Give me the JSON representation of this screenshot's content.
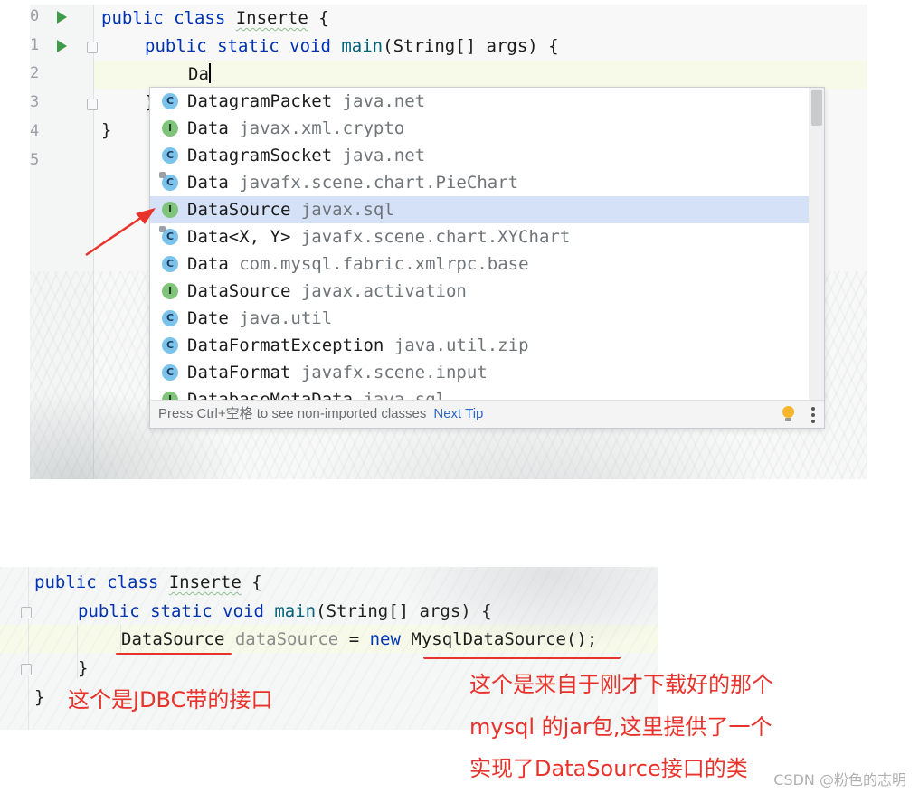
{
  "editor_top": {
    "line_numbers": [
      "0",
      "1",
      "2",
      "3",
      "4",
      "5"
    ],
    "code": {
      "line1": {
        "kw": "public class",
        "name": "Inserte",
        "brace": "{"
      },
      "line2": {
        "kw": "public static void",
        "fn": "main",
        "rest": "(String[] args) {"
      },
      "line3": {
        "typed": "Da"
      },
      "line4": {
        "text": "}"
      },
      "line5": {
        "text": "}"
      }
    }
  },
  "completion_popup": {
    "items": [
      {
        "name": "DatagramPacket",
        "package": "java.net",
        "kind": "C"
      },
      {
        "name": "Data",
        "package": "javax.xml.crypto",
        "kind": "I"
      },
      {
        "name": "DatagramSocket",
        "package": "java.net",
        "kind": "C"
      },
      {
        "name": "Data",
        "package": "javafx.scene.chart.PieChart",
        "kind": "C"
      },
      {
        "name": "DataSource",
        "package": "javax.sql",
        "kind": "I"
      },
      {
        "name": "Data<X, Y>",
        "package": "javafx.scene.chart.XYChart",
        "kind": "C"
      },
      {
        "name": "Data",
        "package": "com.mysql.fabric.xmlrpc.base",
        "kind": "C"
      },
      {
        "name": "DataSource",
        "package": "javax.activation",
        "kind": "I"
      },
      {
        "name": "Date",
        "package": "java.util",
        "kind": "C"
      },
      {
        "name": "DataFormatException",
        "package": "java.util.zip",
        "kind": "C"
      },
      {
        "name": "DataFormat",
        "package": "javafx.scene.input",
        "kind": "C"
      },
      {
        "name": "DatabaseMetaData",
        "package": "java.sql",
        "kind": "I"
      }
    ],
    "selected_index": 4,
    "footer_text": "Press Ctrl+空格 to see non-imported classes",
    "next_tip": "Next Tip"
  },
  "editor_bottom": {
    "line1": {
      "kw": "public class",
      "name": "Inserte",
      "brace": "{"
    },
    "line2": {
      "kw": "public static void",
      "fn": "main",
      "rest": "(String[] args) {"
    },
    "line3": {
      "type": "DataSource",
      "var": "dataSource",
      "op": "=",
      "kw": "new",
      "call": "MysqlDataSource();"
    },
    "line4": {
      "text": "}"
    },
    "line5": {
      "text": "}"
    }
  },
  "annotations": {
    "interface_note": "这个是JDBC带的接口",
    "impl_note_1": "这个是来自于刚才下载好的那个",
    "impl_note_2": "mysql 的jar包,这里提供了一个",
    "impl_note_3": "实现了DataSource接口的类"
  },
  "watermark": "CSDN @粉色的志明",
  "colors": {
    "annotation_red": "#e8322b",
    "keyword": "#0033b3",
    "selection": "#d5e1f7"
  }
}
